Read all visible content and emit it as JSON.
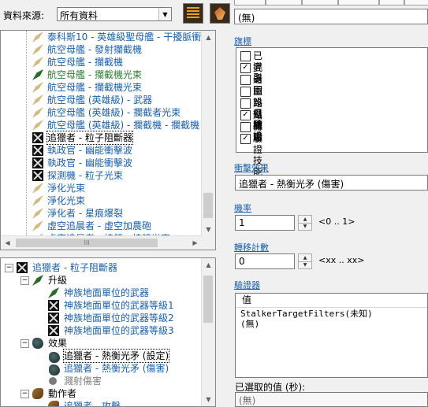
{
  "toolbar": {
    "source_label": "資料來源:",
    "source_value": "所有資料",
    "tabs": [
      "",
      "",
      "",
      "",
      "",
      ""
    ]
  },
  "top_tree": {
    "rows": [
      {
        "icon": "feather",
        "text": "泰科斯10 - 英雄級聖母艦 - 干擾脈衝",
        "style": "link"
      },
      {
        "icon": "feather",
        "text": "航空母艦 - 發射攔截機",
        "style": "link"
      },
      {
        "icon": "feather",
        "text": "航空母艦 - 攔截機",
        "style": "link"
      },
      {
        "icon": "leaf",
        "text": "航空母艦 - 攔截機光束",
        "style": "green"
      },
      {
        "icon": "feather",
        "text": "航空母艦 - 攔截機光束",
        "style": "link"
      },
      {
        "icon": "feather",
        "text": "航空母艦 (英雄級) - 武器",
        "style": "link"
      },
      {
        "icon": "feather",
        "text": "航空母艦 (英雄級) - 攔截者光束",
        "style": "link"
      },
      {
        "icon": "feather",
        "text": "航空母艦 (英雄級) - 攔截機 - 攔截機",
        "style": "link"
      },
      {
        "icon": "x",
        "text": "追獵者 - 粒子阻斷器",
        "style": "sel"
      },
      {
        "icon": "x",
        "text": "執政官 - 幽能衝擊波",
        "style": "link"
      },
      {
        "icon": "x",
        "text": "執政官 - 幽能衝擊波",
        "style": "link"
      },
      {
        "icon": "x",
        "text": "探測機 - 粒子光束",
        "style": "link"
      },
      {
        "icon": "feather",
        "text": "淨化光束",
        "style": "link"
      },
      {
        "icon": "feather",
        "text": "淨化光束",
        "style": "link"
      },
      {
        "icon": "feather",
        "text": "淨化者 - 星痕爆裂",
        "style": "link"
      },
      {
        "icon": "feather",
        "text": "虛空追晨者 - 虛空加農砲",
        "style": "link"
      },
      {
        "icon": "feather",
        "text": "虛空追晨者 - 棱鏡 - 棱鏡光束",
        "style": "link"
      }
    ],
    "hscroll_glyph": "III"
  },
  "bottom_tree": {
    "root": "追獵者 - 粒子阻斷器",
    "upgrade_header": "升級",
    "upgrades": [
      "神族地面單位的武器",
      "神族地面單位的武器等級1",
      "神族地面單位的武器等級2",
      "神族地面單位的武器等級3"
    ],
    "effect_header": "效果",
    "effects": [
      {
        "text": "追獵者 - 熱衡光矛 (設定)",
        "style": "sel"
      },
      {
        "text": "追獵者 - 熱衡光矛 (傷害)",
        "style": "link"
      },
      {
        "text": "濺射傷害",
        "style": "gray"
      }
    ],
    "actor_header": "動作者",
    "actors": [
      "追獵者 - 攻擊"
    ]
  },
  "right": {
    "top_field": "(無)",
    "flags_label": "旗標",
    "flags": [
      {
        "label": "已導引",
        "checked": false
      },
      {
        "label": "武器",
        "checked": true
      },
      {
        "label": "返回",
        "checked": false
      },
      {
        "label": "重設目標",
        "checked": false
      },
      {
        "label": "路徑驗證",
        "checked": false
      },
      {
        "label": "點撤退",
        "checked": true
      },
      {
        "label": "轉移",
        "checked": false
      },
      {
        "label": "驗證技能",
        "checked": true
      }
    ],
    "effect_label": "衝擊效果",
    "effect_value": "追獵者 - 熱衡光矛 (傷害)",
    "chance_label": "機率",
    "chance_value": "1",
    "chance_range": "<0 .. 1>",
    "transfer_label": "轉移計數",
    "transfer_value": "0",
    "transfer_range": "<xx .. xx>",
    "validator_label": "驗證器",
    "validator_header": "值",
    "validator_lines": [
      "StalkerTargetFilters(未知)",
      "(無)"
    ],
    "selected_label": "已選取的值 (秒):",
    "selected_value": "(無)"
  },
  "colors": {
    "link": "#1a5fa8",
    "green": "#2e7d32",
    "gray": "#808080"
  }
}
